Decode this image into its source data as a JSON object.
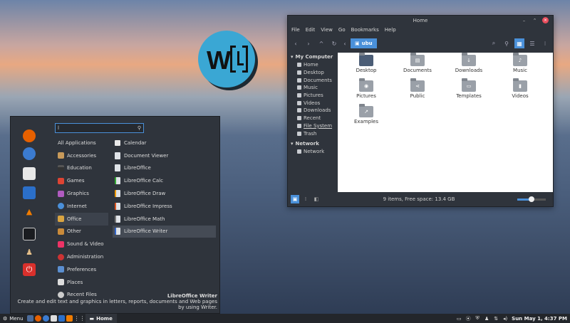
{
  "file_manager": {
    "title": "Home",
    "menu": [
      "File",
      "Edit",
      "View",
      "Go",
      "Bookmarks",
      "Help"
    ],
    "breadcrumb": "ubu",
    "sidebar": {
      "my_computer_label": "My Computer",
      "my_computer_items": [
        "Home",
        "Desktop",
        "Documents",
        "Music",
        "Pictures",
        "Videos",
        "Downloads",
        "Recent",
        "File System",
        "Trash"
      ],
      "network_label": "Network",
      "network_items": [
        "Network"
      ]
    },
    "files": [
      "Desktop",
      "Documents",
      "Downloads",
      "Music",
      "Pictures",
      "Public",
      "Templates",
      "Videos",
      "Examples"
    ],
    "status": "9 items, Free space: 13.4 GB",
    "zoom_level": 0.5
  },
  "menu": {
    "search_value": "l",
    "categories": [
      "All Applications",
      "Accessories",
      "Education",
      "Games",
      "Graphics",
      "Internet",
      "Office",
      "Other",
      "Sound & Video",
      "Administration",
      "Preferences",
      "Places",
      "Recent Files"
    ],
    "selected_category": "Office",
    "apps": [
      "Calendar",
      "Document Viewer",
      "LibreOffice",
      "LibreOffice Calc",
      "LibreOffice Draw",
      "LibreOffice Impress",
      "LibreOffice Math",
      "LibreOffice Writer"
    ],
    "selected_app": "LibreOffice Writer",
    "desc_title": "LibreOffice Writer",
    "desc_text": "Create and edit text and graphics in letters, reports, documents and Web pages by using Writer."
  },
  "taskbar": {
    "menu_label": "Menu",
    "window_label": "Home",
    "clock": "Sun May 1, 4:37 PM"
  },
  "colors": {
    "accent": "#4a90d9",
    "panel": "#2f343c",
    "close": "#e84d5c"
  }
}
